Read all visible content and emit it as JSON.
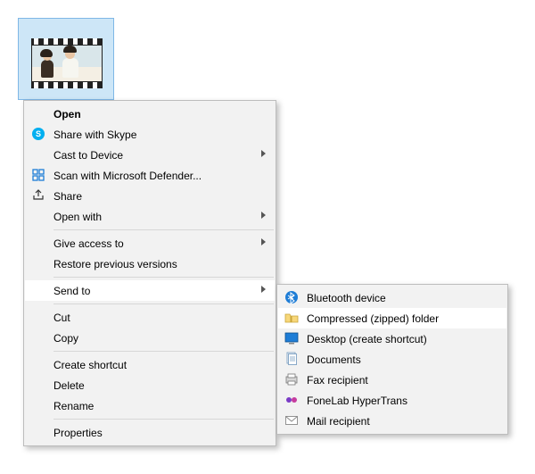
{
  "file": {
    "kind": "video",
    "selected": true
  },
  "contextMenu": {
    "items": {
      "open": {
        "label": "Open"
      },
      "share_skype": {
        "label": "Share with Skype"
      },
      "cast": {
        "label": "Cast to Device"
      },
      "defender": {
        "label": "Scan with Microsoft Defender..."
      },
      "share": {
        "label": "Share"
      },
      "open_with": {
        "label": "Open with"
      },
      "give_access": {
        "label": "Give access to"
      },
      "restore_prev": {
        "label": "Restore previous versions"
      },
      "send_to": {
        "label": "Send to"
      },
      "cut": {
        "label": "Cut"
      },
      "copy": {
        "label": "Copy"
      },
      "create_shortcut": {
        "label": "Create shortcut"
      },
      "delete": {
        "label": "Delete"
      },
      "rename": {
        "label": "Rename"
      },
      "properties": {
        "label": "Properties"
      }
    }
  },
  "sendToMenu": {
    "items": {
      "bluetooth": {
        "label": "Bluetooth device"
      },
      "zip": {
        "label": "Compressed (zipped) folder"
      },
      "desktop": {
        "label": "Desktop (create shortcut)"
      },
      "documents": {
        "label": "Documents"
      },
      "fax": {
        "label": "Fax recipient"
      },
      "hypertrans": {
        "label": "FoneLab HyperTrans"
      },
      "mail": {
        "label": "Mail recipient"
      }
    }
  }
}
